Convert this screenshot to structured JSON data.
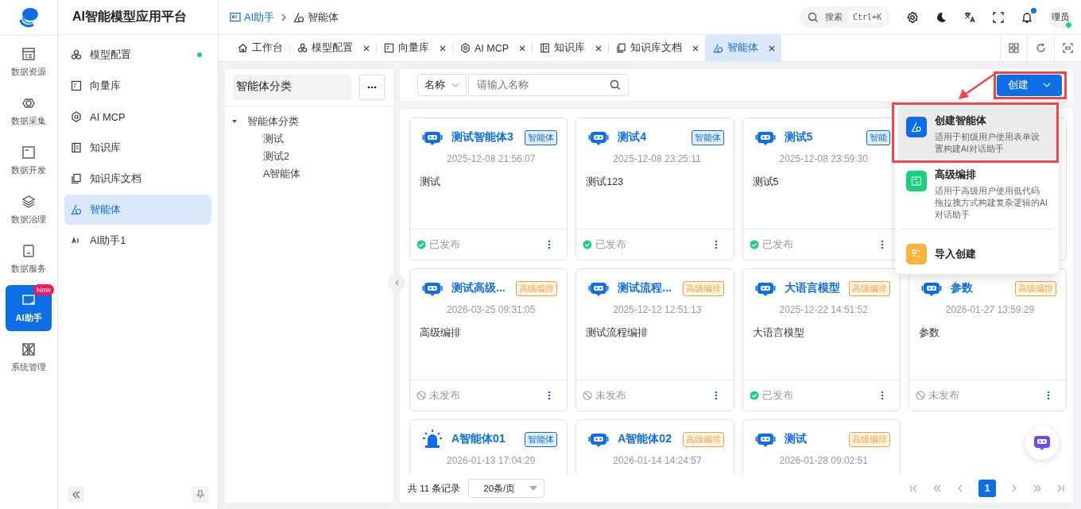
{
  "app_title": "AI智能模型应用平台",
  "breadcrumb": [
    {
      "label": "AI助手"
    },
    {
      "label": "智能体"
    }
  ],
  "header": {
    "search": {
      "placeholder": "搜索",
      "shortcut": "Ctrl+K"
    },
    "notifications": {
      "unread": true
    },
    "user": {
      "name": "理员",
      "online": true
    }
  },
  "rail": [
    {
      "label": "数据资源",
      "selected": false
    },
    {
      "label": "数据采集",
      "selected": false
    },
    {
      "label": "数据开发",
      "selected": false
    },
    {
      "label": "数据治理",
      "selected": false
    },
    {
      "label": "数据服务",
      "selected": false
    },
    {
      "label": "AI助手",
      "selected": true,
      "badge": "New"
    },
    {
      "label": "系统管理",
      "selected": false
    }
  ],
  "sidebar": [
    {
      "label": "模型配置",
      "selected": false,
      "dot": true
    },
    {
      "label": "向量库",
      "selected": false,
      "dot": false
    },
    {
      "label": "AI MCP",
      "selected": false,
      "dot": false
    },
    {
      "label": "知识库",
      "selected": false,
      "dot": false
    },
    {
      "label": "知识库文档",
      "selected": false,
      "dot": false
    },
    {
      "label": "智能体",
      "selected": true,
      "dot": false
    },
    {
      "label": "AI助手1",
      "selected": false,
      "dot": false
    }
  ],
  "tabs": [
    {
      "label": "工作台",
      "selected": false,
      "closable": false
    },
    {
      "label": "模型配置",
      "selected": false,
      "closable": true
    },
    {
      "label": "向量库",
      "selected": false,
      "closable": true
    },
    {
      "label": "AI MCP",
      "selected": false,
      "closable": true
    },
    {
      "label": "知识库",
      "selected": false,
      "closable": true
    },
    {
      "label": "知识库文档",
      "selected": false,
      "closable": true
    },
    {
      "label": "智能体",
      "selected": true,
      "closable": true
    }
  ],
  "category_panel": {
    "title": "智能体分类",
    "tree": [
      {
        "label": "智能体分类",
        "expanded": true,
        "children": [
          {
            "label": "测试"
          },
          {
            "label": "测试2"
          },
          {
            "label": "A智能体"
          }
        ]
      }
    ]
  },
  "filter": {
    "field": "名称",
    "placeholder": "请输入名称"
  },
  "create_button": "创建",
  "create_menu": [
    {
      "title": "创建智能体",
      "description": "适用于初级用户使用表单设置构建AI对话助手",
      "color": "#0e6ee6",
      "selected": true
    },
    {
      "title": "高级编排",
      "description": "适用于高级用户使用低代码拖拉拽方式构建复杂逻辑的AI对话助手",
      "color": "#1ccf7f",
      "selected": false
    },
    {
      "title": "导入创建",
      "color": "#f7b53b",
      "selected": false
    }
  ],
  "cards": [
    {
      "kind": "robot",
      "name": "测试智能体3",
      "tag": "智能体",
      "color": "#0e6ee6",
      "date": "2025-12-08 21:56:07",
      "description": "测试",
      "published": true,
      "status": "已发布"
    },
    {
      "kind": "robot",
      "name": "测试4",
      "tag": "智能体",
      "color": "#0e6ee6",
      "date": "2025-12-08 23:25:11",
      "description": "测试123",
      "published": true,
      "status": "已发布"
    },
    {
      "kind": "robot",
      "name": "测试5",
      "tag": "智能",
      "color": "#0e6ee6",
      "date": "2025-12-08 23:59:30",
      "description": "测试5",
      "published": true,
      "status": "已发布"
    },
    {
      "kind": "covered"
    },
    {
      "kind": "robot",
      "name": "测试高级...",
      "tag": "高级编排",
      "color": "#f5a23b",
      "date": "2026-03-25 09:31:05",
      "description": "高级编排",
      "published": false,
      "status": "未发布"
    },
    {
      "kind": "robot",
      "name": "测试流程...",
      "tag": "高级编排",
      "color": "#f5a23b",
      "date": "2025-12-12 12:51:13",
      "description": "测试流程编排",
      "published": false,
      "status": "未发布"
    },
    {
      "kind": "robot",
      "name": "大语言模型",
      "tag": "高级编排",
      "color": "#f5a23b",
      "date": "2025-12-22 14:51:52",
      "description": "大语言模型",
      "published": true,
      "status": "已发布"
    },
    {
      "kind": "robot",
      "name": "参数",
      "tag": "高级编排",
      "color": "#f5a23b",
      "date": "2026-01-27 13:59:29",
      "description": "参数",
      "published": false,
      "status": "未发布"
    },
    {
      "kind": "alarm",
      "name": "A智能体01",
      "tag": "智能体",
      "color": "#0e6ee6",
      "date": "2026-01-13 17:04:29"
    },
    {
      "kind": "robot",
      "name": "A智能体02",
      "tag": "高级编排",
      "color": "#f5a23b",
      "date": "2026-01-14 14:24:57"
    },
    {
      "kind": "robot",
      "name": "测试",
      "tag": "高级编排",
      "color": "#f5a23b",
      "date": "2026-01-28 09:02:51"
    }
  ],
  "pagination": {
    "total": "共 11 条记录",
    "page_size": "20条/页",
    "pages": [
      {
        "label": "1",
        "selected": true
      }
    ]
  }
}
